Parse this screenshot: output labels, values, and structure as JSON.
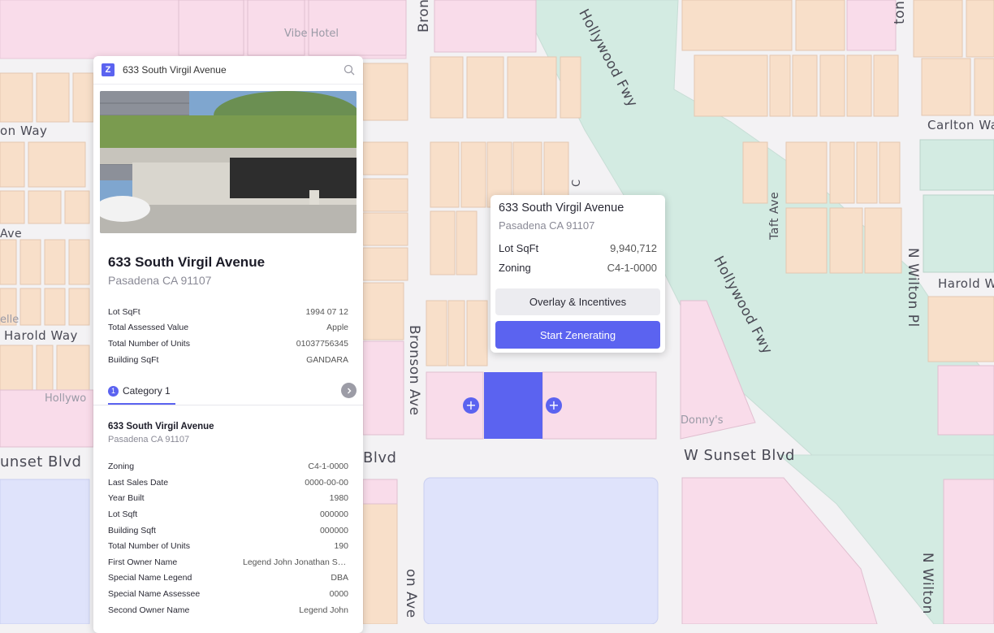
{
  "map": {
    "streets": {
      "bronson_top": "Bron",
      "hollywood_fwy_top": "Hollywood Fwy",
      "wilton_pl_top": "ton Pl",
      "carlton_way": "Carlton Wa",
      "taft_ave": "Taft Ave",
      "bronson_ave": "Bronson Ave",
      "hollywood_fwy": "Hollywood Fwy",
      "n_wilton_pl": "N Wilton Pl",
      "harold_way_right": "Harold W",
      "w_sunset_blvd": "W Sunset Blvd",
      "sunset_left": "unset Blvd",
      "blvd_mid": "Blvd",
      "n_wilton_bottom": "N Wilton",
      "bronson_bottom": "on Ave",
      "on_way": "on Way",
      "ave_left": "Ave",
      "harold_way_left": "Harold Way",
      "c_fragment": "C"
    },
    "pois": {
      "vibe_hotel": "Vibe Hotel",
      "donnys": "Donny's",
      "hollywood_left": "Hollywo",
      "elle": "elle"
    }
  },
  "panel": {
    "search": {
      "value": "633 South Virgil Avenue",
      "logo_letter": "Z"
    },
    "title": "633 South Virgil Avenue",
    "subtitle": "Pasadena CA 91107",
    "summary": [
      {
        "label": "Lot SqFt",
        "value": "1994 07 12"
      },
      {
        "label": "Total Assessed Value",
        "value": "Apple"
      },
      {
        "label": "Total Number of Units",
        "value": "01037756345"
      },
      {
        "label": "Building SqFt",
        "value": "GANDARA"
      }
    ],
    "tab": {
      "number": "1",
      "label": "Category 1"
    },
    "section": {
      "title": "633 South Virgil Avenue",
      "subtitle": "Pasadena CA 91107",
      "rows": [
        {
          "label": "Zoning",
          "value": "C4-1-0000"
        },
        {
          "label": "Last Sales Date",
          "value": "0000-00-00"
        },
        {
          "label": "Year Built",
          "value": "1980"
        },
        {
          "label": "Lot Sqft",
          "value": "000000"
        },
        {
          "label": "Building Sqft",
          "value": "000000"
        },
        {
          "label": "Total Number of Units",
          "value": "190"
        },
        {
          "label": "First Owner Name",
          "value": "Legend John Jonathan Smith"
        },
        {
          "label": "Special Name Legend",
          "value": "DBA"
        },
        {
          "label": "Special Name Assessee",
          "value": "0000"
        },
        {
          "label": "Second Owner Name",
          "value": "Legend John"
        }
      ]
    }
  },
  "popup": {
    "title": "633 South Virgil Avenue",
    "subtitle": "Pasadena CA 91107",
    "lot_label": "Lot SqFt",
    "lot_value": "9,940,712",
    "zoning_label": "Zoning",
    "zoning_value": "C4-1-0000",
    "overlay_button": "Overlay & Incentives",
    "start_button": "Start Zenerating"
  },
  "colors": {
    "accent": "#5b63f0",
    "parcel_tan": "#f8dfc9",
    "parcel_pink": "#f9dcea",
    "parcel_blue": "#dfe3fb",
    "freeway_green": "#d2ebe2"
  }
}
